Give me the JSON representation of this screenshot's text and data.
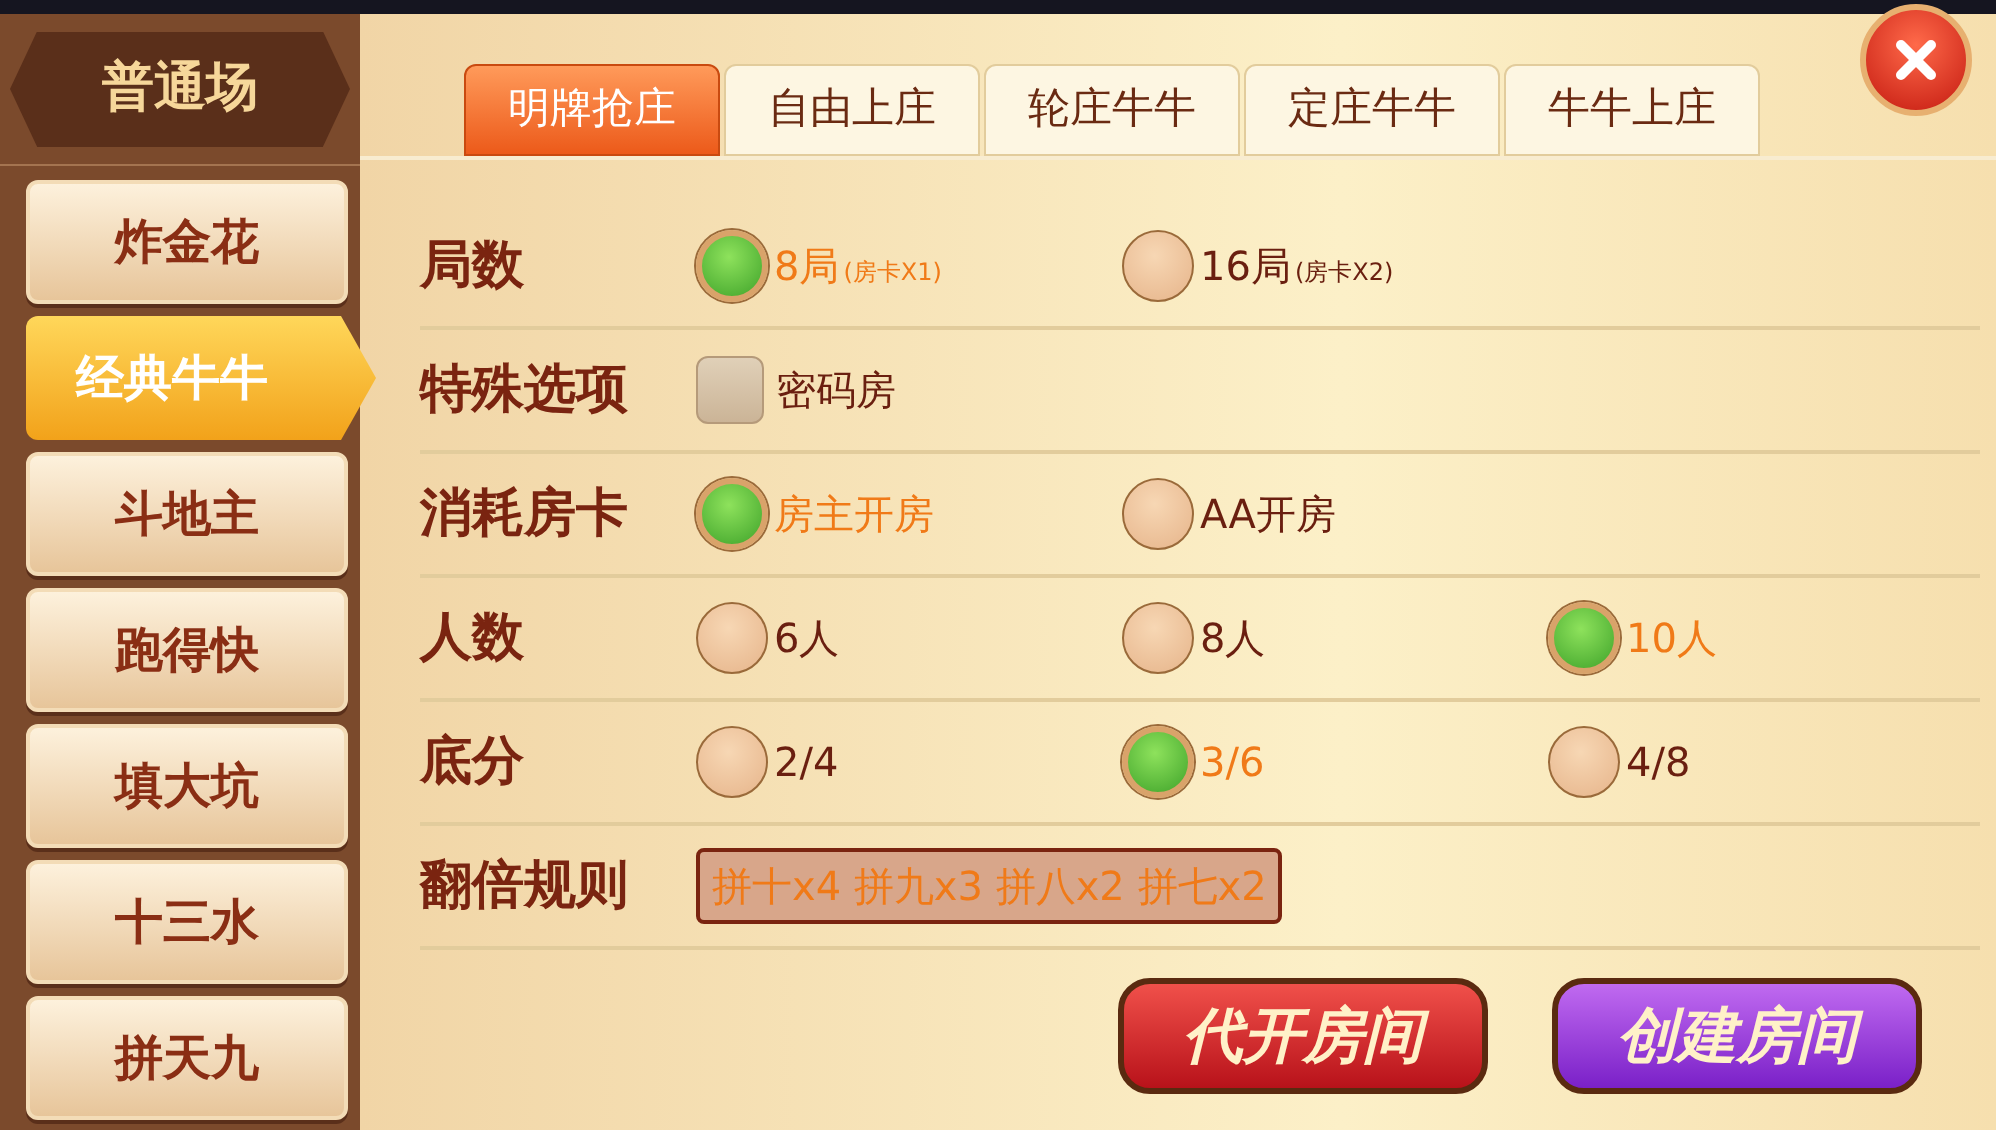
{
  "category": {
    "title": "普通场"
  },
  "games": [
    {
      "label": "炸金花",
      "selected": false
    },
    {
      "label": "经典牛牛",
      "selected": true
    },
    {
      "label": "斗地主",
      "selected": false
    },
    {
      "label": "跑得快",
      "selected": false
    },
    {
      "label": "填大坑",
      "selected": false
    },
    {
      "label": "十三水",
      "selected": false
    },
    {
      "label": "拼天九",
      "selected": false
    }
  ],
  "tabs": [
    {
      "label": "明牌抢庄",
      "selected": true
    },
    {
      "label": "自由上庄",
      "selected": false
    },
    {
      "label": "轮庄牛牛",
      "selected": false
    },
    {
      "label": "定庄牛牛",
      "selected": false
    },
    {
      "label": "牛牛上庄",
      "selected": false
    }
  ],
  "rows": [
    {
      "kind": "radio",
      "label": "局数",
      "options": [
        {
          "text": "8局",
          "note": "(房卡X1)",
          "selected": true
        },
        {
          "text": "16局",
          "note": "(房卡X2)",
          "selected": false
        }
      ]
    },
    {
      "kind": "checkbox",
      "label": "特殊选项",
      "options": [
        {
          "text": "密码房",
          "checked": false
        }
      ]
    },
    {
      "kind": "radio",
      "label": "消耗房卡",
      "options": [
        {
          "text": "房主开房",
          "selected": true
        },
        {
          "text": "AA开房",
          "selected": false
        }
      ]
    },
    {
      "kind": "radio",
      "label": "人数",
      "options": [
        {
          "text": "6人",
          "selected": false
        },
        {
          "text": "8人",
          "selected": false
        },
        {
          "text": "10人",
          "selected": true
        }
      ]
    },
    {
      "kind": "radio",
      "label": "底分",
      "options": [
        {
          "text": "2/4",
          "selected": false
        },
        {
          "text": "3/6",
          "selected": true
        },
        {
          "text": "4/8",
          "selected": false
        }
      ]
    },
    {
      "kind": "text",
      "label": "翻倍规则",
      "value": "拼十x4 拼九x3 拼八x2 拼七x2"
    }
  ],
  "buttons": [
    {
      "label": "代开房间",
      "kind": "red"
    },
    {
      "label": "创建房间",
      "kind": "purple"
    }
  ]
}
